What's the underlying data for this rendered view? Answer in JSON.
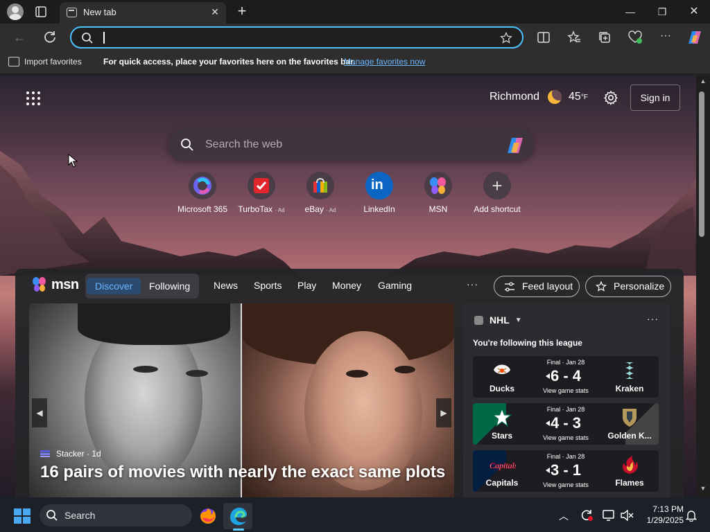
{
  "browser": {
    "tab_title": "New tab",
    "address_value": "",
    "favorites_bar": {
      "import_label": "Import favorites",
      "message": "For quick access, place your favorites here on the favorites bar.",
      "link": "Manage favorites now"
    }
  },
  "newtab": {
    "weather": {
      "city": "Richmond",
      "temp": "45",
      "unit": "°F"
    },
    "signin_label": "Sign in",
    "search_placeholder": "Search the web",
    "shortcuts": [
      {
        "label": "Microsoft 365",
        "ad": ""
      },
      {
        "label": "TurboTax",
        "ad": "· Ad"
      },
      {
        "label": "eBay",
        "ad": "· Ad"
      },
      {
        "label": "LinkedIn",
        "ad": ""
      },
      {
        "label": "MSN",
        "ad": ""
      },
      {
        "label": "Add shortcut",
        "ad": ""
      }
    ]
  },
  "feed": {
    "logo_text": "msn",
    "tabs": [
      "Discover",
      "Following"
    ],
    "nav": [
      "News",
      "Sports",
      "Play",
      "Money",
      "Gaming"
    ],
    "more": "···",
    "feed_layout": "Feed layout",
    "personalize": "Personalize",
    "hero": {
      "source": "Stacker",
      "age": "· 1d",
      "title": "16 pairs of movies with nearly the exact same plots"
    },
    "nhl": {
      "title": "NHL",
      "subtitle": "You're following this league",
      "more": "···",
      "games": [
        {
          "status": "Final · Jan 28",
          "score": "6 - 4",
          "stats": "View game stats",
          "home": "Ducks",
          "away": "Kraken"
        },
        {
          "status": "Final · Jan 28",
          "score": "4 - 3",
          "stats": "View game stats",
          "home": "Stars",
          "away": "Golden K..."
        },
        {
          "status": "Final · Jan 28",
          "score": "3 - 1",
          "stats": "View game stats",
          "home": "Capitals",
          "away": "Flames"
        }
      ]
    }
  },
  "taskbar": {
    "search_placeholder": "Search",
    "time": "7:13 PM",
    "date": "1/29/2025"
  },
  "colors": {
    "accent": "#4cc2ff",
    "link": "#6cb8ff",
    "active_tab": "#6cb4ff"
  }
}
